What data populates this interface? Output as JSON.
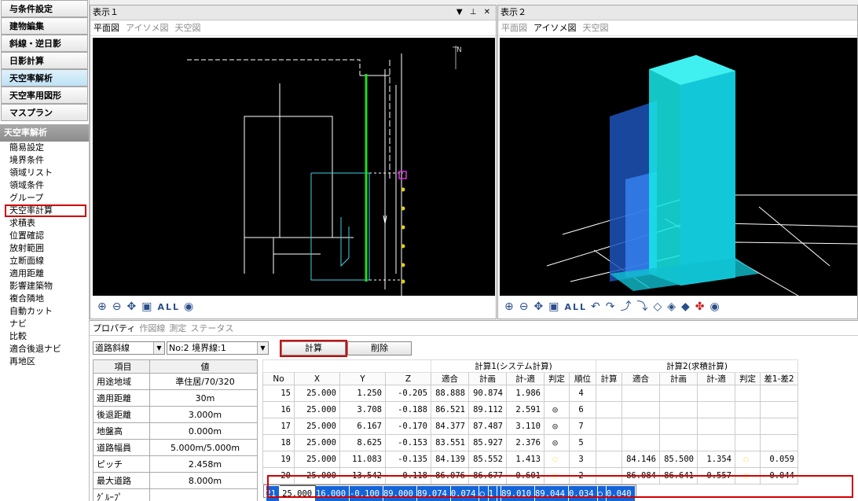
{
  "sidebar": {
    "main_buttons": [
      {
        "label": "与条件設定",
        "active": false
      },
      {
        "label": "建物編集",
        "active": false
      },
      {
        "label": "斜線・逆日影",
        "active": false
      },
      {
        "label": "日影計算",
        "active": false
      },
      {
        "label": "天空率解析",
        "active": true
      },
      {
        "label": "天空率用図形",
        "active": false
      },
      {
        "label": "マスプラン",
        "active": false
      }
    ],
    "section_title": "天空率解析",
    "items": [
      "簡易設定",
      "境界条件",
      "領域リスト",
      "領域条件",
      "グループ",
      "天空率計算",
      "求積表",
      "位置確認",
      "放射範囲",
      "立断面線",
      "適用距離",
      "影響建築物",
      "複合隣地",
      "自動カット",
      "ナビ",
      "比較",
      "適合後退ナビ",
      "再地区"
    ],
    "highlighted_item": "天空率計算"
  },
  "view1": {
    "title": "表示１",
    "controls": "▼ ⊥ ✕",
    "tabs": [
      "平面図",
      "アイソメ図",
      "天空図"
    ],
    "active_tab": "平面図",
    "north": "N"
  },
  "view2": {
    "title": "表示２",
    "tabs": [
      "平面図",
      "アイソメ図",
      "天空図"
    ],
    "active_tab": "アイソメ図"
  },
  "toolbar1": {
    "icons": [
      "zoom-in-icon",
      "zoom-out-icon",
      "pan-icon",
      "zoom-window-icon",
      "all-icon",
      "eye-icon"
    ],
    "all_label": "ALL"
  },
  "toolbar2": {
    "all_label": "ALL"
  },
  "bottom": {
    "tabs": [
      "プロパティ",
      "作図線",
      "測定",
      "ステータス"
    ],
    "active_tab": "プロパティ",
    "select1": "道路斜線",
    "select2": "No:2 境界線:1",
    "calc_button": "計算",
    "delete_button": "削除"
  },
  "properties": {
    "header": [
      "項目",
      "値"
    ],
    "rows": [
      [
        "用途地域",
        "準住居/70/320"
      ],
      [
        "適用距離",
        "30m"
      ],
      [
        "後退距離",
        "3.000m"
      ],
      [
        "地盤高",
        "0.000m"
      ],
      [
        "道路幅員",
        "5.000m/5.000m"
      ],
      [
        "ピッチ",
        "2.458m"
      ],
      [
        "最大道路",
        "8.000m"
      ],
      [
        "ｸﾞﾙｰﾌﾟ",
        ""
      ]
    ]
  },
  "results": {
    "group1": "計算1(システム計算)",
    "group2": "計算2(求積計算)",
    "columns": [
      "No",
      "X",
      "Y",
      "Z",
      "適合",
      "計画",
      "計-適",
      "判定",
      "順位",
      "計算",
      "適合",
      "計画",
      "計-適",
      "判定",
      "差1-差2"
    ],
    "rows": [
      [
        "15",
        "25.000",
        "1.250",
        "-0.205",
        "88.888",
        "90.874",
        "1.986",
        "",
        "4",
        "",
        "",
        "",
        "",
        "",
        ""
      ],
      [
        "16",
        "25.000",
        "3.708",
        "-0.188",
        "86.521",
        "89.112",
        "2.591",
        "◎",
        "6",
        "",
        "",
        "",
        "",
        "",
        ""
      ],
      [
        "17",
        "25.000",
        "6.167",
        "-0.170",
        "84.377",
        "87.487",
        "3.110",
        "◎",
        "7",
        "",
        "",
        "",
        "",
        "",
        ""
      ],
      [
        "18",
        "25.000",
        "8.625",
        "-0.153",
        "83.551",
        "85.927",
        "2.376",
        "◎",
        "5",
        "",
        "",
        "",
        "",
        "",
        ""
      ],
      [
        "19",
        "25.000",
        "11.083",
        "-0.135",
        "84.139",
        "85.552",
        "1.413",
        "○",
        "3",
        "",
        "84.146",
        "85.500",
        "1.354",
        "○",
        "0.059"
      ],
      [
        "20",
        "25.000",
        "13.542",
        "-0.118",
        "86.076",
        "86.677",
        "0.601",
        "○",
        "2",
        "",
        "86.084",
        "86.641",
        "0.557",
        "○",
        "0.044"
      ],
      [
        "21",
        "25.000",
        "16.000",
        "-0.100",
        "89.000",
        "89.074",
        "0.074",
        "○",
        "1",
        "",
        "89.010",
        "89.044",
        "0.034",
        "○",
        "0.040"
      ]
    ],
    "selected_row": "21"
  }
}
